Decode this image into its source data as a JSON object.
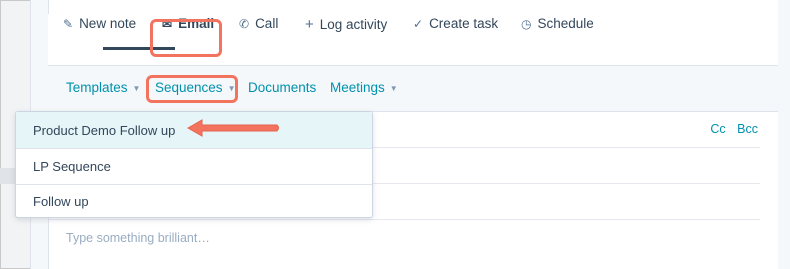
{
  "tabs": [
    {
      "icon": "pencil-icon",
      "glyph": "✎",
      "label": "New note"
    },
    {
      "icon": "envelope-icon",
      "glyph": "✉",
      "label": "Email"
    },
    {
      "icon": "phone-icon",
      "glyph": "✆",
      "label": "Call"
    },
    {
      "icon": "plus-icon",
      "glyph": "+",
      "label": "Log activity"
    },
    {
      "icon": "check-circle-icon",
      "glyph": "✓",
      "label": "Create task"
    },
    {
      "icon": "clock-icon",
      "glyph": "◷",
      "label": "Schedule"
    }
  ],
  "subtabs": {
    "templates": "Templates",
    "sequences": "Sequences",
    "documents": "Documents",
    "meetings": "Meetings"
  },
  "email_fields": {
    "cc": "Cc",
    "bcc": "Bcc",
    "body_placeholder": "Type something brilliant…"
  },
  "sequences_dropdown": {
    "items": [
      "Product Demo Follow up",
      "LP Sequence",
      "Follow up"
    ],
    "highlighted_index": 0
  },
  "colors": {
    "accent": "#0091ae",
    "highlight": "#f2745f",
    "text": "#33475b"
  }
}
